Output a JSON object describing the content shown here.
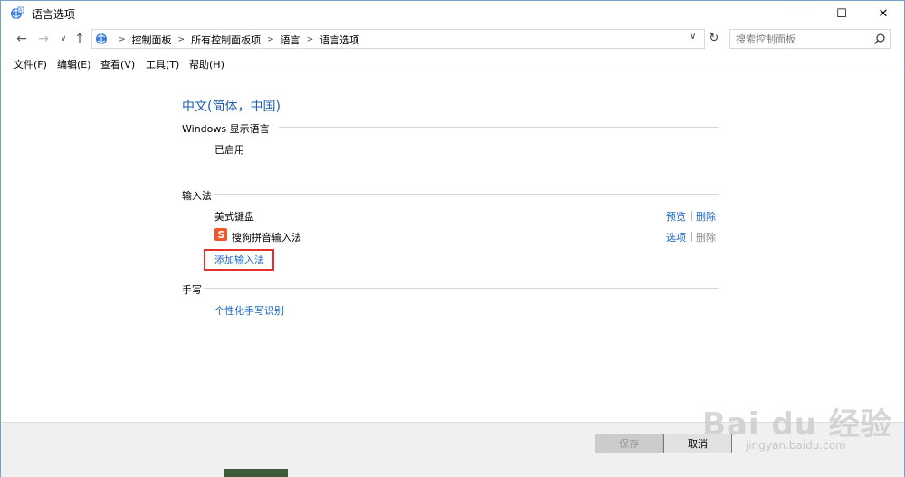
{
  "window": {
    "title": "语言选项",
    "minimize_glyph": "—",
    "maximize_glyph": "☐",
    "close_glyph": "✕"
  },
  "address": {
    "crumbs": [
      "控制面板",
      "所有控制面板项",
      "语言",
      "语言选项"
    ]
  },
  "search": {
    "placeholder": "搜索控制面板"
  },
  "menu": [
    {
      "label": "文件(F)"
    },
    {
      "label": "编辑(E)"
    },
    {
      "label": "查看(V)"
    },
    {
      "label": "工具(T)"
    },
    {
      "label": "帮助(H)"
    }
  ],
  "language": {
    "name": "中文(简体，中国)",
    "display_section": "Windows 显示语言",
    "display_status": "已启用",
    "input_section": "输入法",
    "input_methods": [
      {
        "name": "美式键盘",
        "action1": "预览",
        "action2": "删除"
      },
      {
        "name": "搜狗拼音输入法",
        "action1": "选项",
        "action2": "删除"
      }
    ],
    "add_input": "添加输入法",
    "handwriting_section": "手写",
    "handwriting_link": "个性化手写识别"
  },
  "footer": {
    "save": "保存",
    "cancel": "取消"
  },
  "watermark": {
    "main": "Bai du 经验",
    "sub": "jingyan.baidu.com"
  },
  "colors": {
    "link": "#1a66c4",
    "title_blue": "#1e5fb4",
    "highlight": "#e53030",
    "sogou_orange": "#f0572a"
  }
}
